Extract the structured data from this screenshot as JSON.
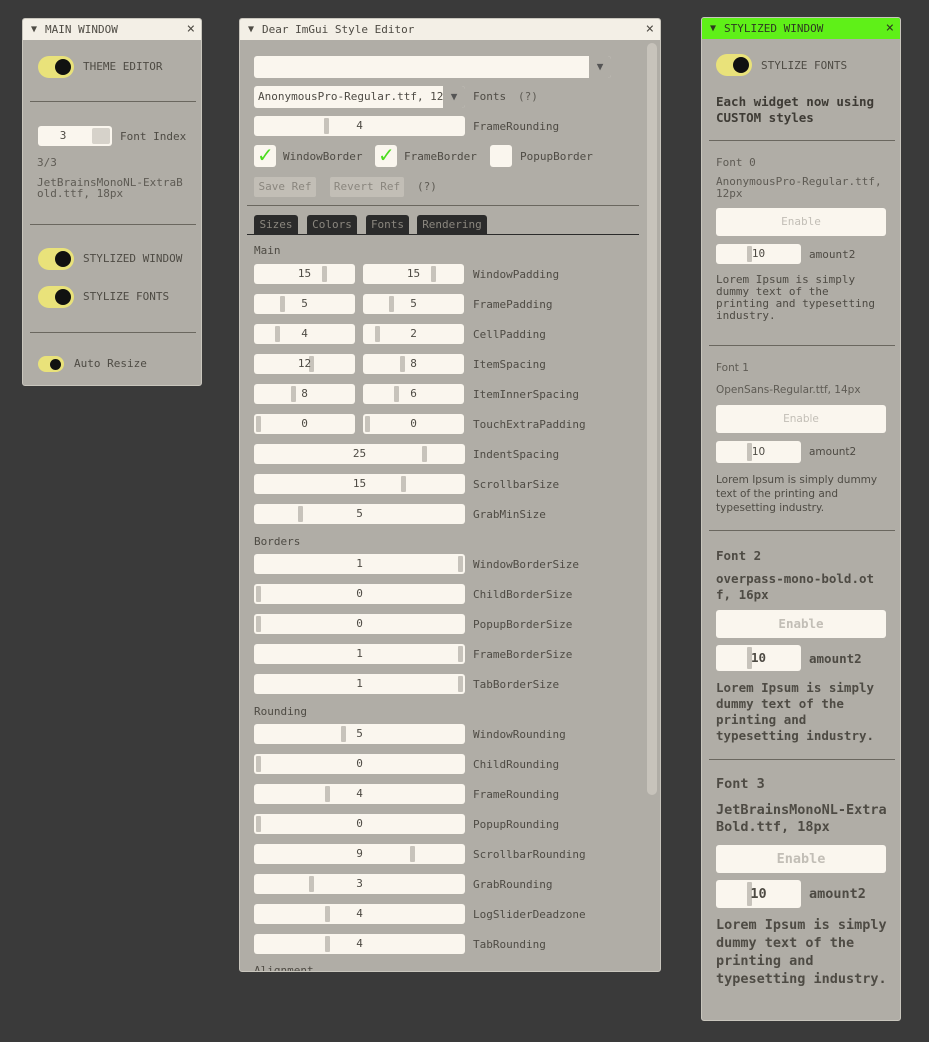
{
  "main_window": {
    "title": "MAIN WINDOW",
    "theme_editor_label": "THEME EDITOR",
    "font_index_value": "3",
    "font_index_label": "Font Index",
    "font_count": "3/3",
    "font_name": "JetBrainsMonoNL-ExtraBold.ttf, 18px",
    "stylized_window_label": "STYLIZED WINDOW",
    "stylize_fonts_label": "STYLIZE FONTS",
    "auto_resize_label": "Auto Resize"
  },
  "style_editor": {
    "title": "Dear ImGui Style Editor",
    "style_combo_value": "",
    "font_combo_value": "AnonymousPro-Regular.ttf, 12",
    "fonts_label": "Fonts",
    "help": "(?)",
    "frame_rounding_value": "4",
    "frame_rounding_label": "FrameRounding",
    "window_border": "WindowBorder",
    "frame_border": "FrameBorder",
    "popup_border": "PopupBorder",
    "save_ref": "Save Ref",
    "revert_ref": "Revert Ref",
    "tabs": [
      "Sizes",
      "Colors",
      "Fonts",
      "Rendering"
    ],
    "section_main": "Main",
    "section_borders": "Borders",
    "section_rounding": "Rounding",
    "section_alignment": "Alignment",
    "main_rows": [
      {
        "label": "WindowPadding",
        "a": "15",
        "b": "15",
        "ga": 0.72,
        "gb": 0.72
      },
      {
        "label": "FramePadding",
        "a": "5",
        "b": "5",
        "ga": 0.26,
        "gb": 0.26
      },
      {
        "label": "CellPadding",
        "a": "4",
        "b": "2",
        "ga": 0.21,
        "gb": 0.11
      },
      {
        "label": "ItemSpacing",
        "a": "12",
        "b": "8",
        "ga": 0.58,
        "gb": 0.38
      },
      {
        "label": "ItemInnerSpacing",
        "a": "8",
        "b": "6",
        "ga": 0.38,
        "gb": 0.31
      }
    ],
    "touch_row": {
      "label": "TouchExtraPadding",
      "a": "0",
      "b": "0"
    },
    "single_rows_main": [
      {
        "label": "IndentSpacing",
        "value": "25",
        "g": 0.82
      },
      {
        "label": "ScrollbarSize",
        "value": "15",
        "g": 0.72
      },
      {
        "label": "GrabMinSize",
        "value": "5",
        "g": 0.21
      }
    ],
    "border_rows": [
      {
        "label": "WindowBorderSize",
        "value": "1",
        "g": 1.0
      },
      {
        "label": "ChildBorderSize",
        "value": "0",
        "g": 0.0
      },
      {
        "label": "PopupBorderSize",
        "value": "0",
        "g": 0.0
      },
      {
        "label": "FrameBorderSize",
        "value": "1",
        "g": 1.0
      },
      {
        "label": "TabBorderSize",
        "value": "1",
        "g": 1.0
      }
    ],
    "rounding_rows": [
      {
        "label": "WindowRounding",
        "value": "5",
        "g": 0.42
      },
      {
        "label": "ChildRounding",
        "value": "0",
        "g": 0.0
      },
      {
        "label": "FrameRounding",
        "value": "4",
        "g": 0.34
      },
      {
        "label": "PopupRounding",
        "value": "0",
        "g": 0.0
      },
      {
        "label": "ScrollbarRounding",
        "value": "9",
        "g": 0.76
      },
      {
        "label": "GrabRounding",
        "value": "3",
        "g": 0.26
      },
      {
        "label": "LogSliderDeadzone",
        "value": "4",
        "g": 0.34
      },
      {
        "label": "TabRounding",
        "value": "4",
        "g": 0.34
      }
    ]
  },
  "stylized_window": {
    "title": "STYLIZED WINDOW",
    "stylize_fonts_label": "STYLIZE FONTS",
    "intro": "Each widget now using CUSTOM styles",
    "fonts": [
      {
        "heading": "Font 0",
        "name": "AnonymousPro-Regular.ttf, 12px",
        "enable": "Enable",
        "amount_value": "10",
        "amount_label": "amount2",
        "lorem": "Lorem Ipsum is simply dummy text of the printing and typesetting industry."
      },
      {
        "heading": "Font 1",
        "name": "OpenSans-Regular.ttf, 14px",
        "enable": "Enable",
        "amount_value": "10",
        "amount_label": "amount2",
        "lorem": "Lorem Ipsum is simply dummy text of the printing and typesetting industry."
      },
      {
        "heading": "Font 2",
        "name": "overpass-mono-bold.otf, 16px",
        "enable": "Enable",
        "amount_value": "10",
        "amount_label": "amount2",
        "lorem": "Lorem Ipsum is simply dummy text of the printing and typesetting industry."
      },
      {
        "heading": "Font 3",
        "name": "JetBrainsMonoNL-ExtraBold.ttf, 18px",
        "enable": "Enable",
        "amount_value": "10",
        "amount_label": "amount2",
        "lorem": "Lorem Ipsum is simply dummy text of the printing and typesetting industry."
      }
    ]
  },
  "colors": {
    "background": "#3a3a3a",
    "window_bg": "#b0ada6",
    "title_bg": "#f3efe6",
    "stylized_title_bg": "#5ff018",
    "toggle_on": "#e9e27a",
    "check_mark": "#4cdc1e"
  },
  "icons": {
    "collapse": "collapse-arrow-icon",
    "close": "close-icon",
    "dropdown": "dropdown-arrow-icon",
    "check": "checkmark-icon"
  }
}
